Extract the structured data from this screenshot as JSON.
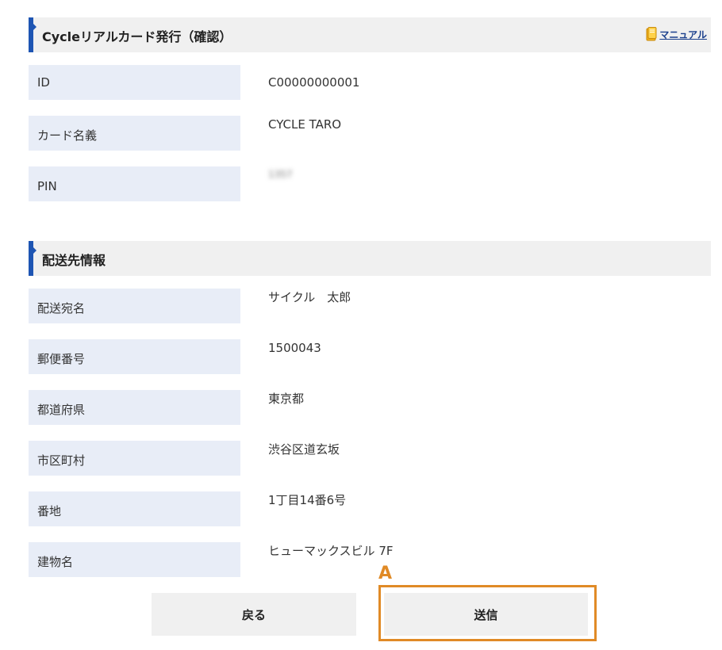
{
  "card_section": {
    "title": "Cycleリアルカード発行（確認）",
    "manual_label": "マニュアル",
    "rows": [
      {
        "label": "ID",
        "value": "C00000000001"
      },
      {
        "label": "カード名義",
        "value": "CYCLE TARO"
      },
      {
        "label": "PIN",
        "value": "1357"
      }
    ]
  },
  "shipping_section": {
    "title": "配送先情報",
    "rows": [
      {
        "label": "配送宛名",
        "value": "サイクル　太郎"
      },
      {
        "label": "郵便番号",
        "value": "1500043"
      },
      {
        "label": "都道府県",
        "value": "東京都"
      },
      {
        "label": "市区町村",
        "value": "渋谷区道玄坂"
      },
      {
        "label": "番地",
        "value": "1丁目14番6号"
      },
      {
        "label": "建物名",
        "value": "ヒューマックスビル 7F"
      }
    ]
  },
  "buttons": {
    "back_label": "戻る",
    "submit_label": "送信"
  },
  "annotation": {
    "label": "A",
    "color": "#e08a26"
  },
  "colors": {
    "accent": "#1e55b3",
    "label_bg": "#e8edf7",
    "header_bg": "#f0f0f0",
    "button_bg": "#f0f0f0"
  }
}
